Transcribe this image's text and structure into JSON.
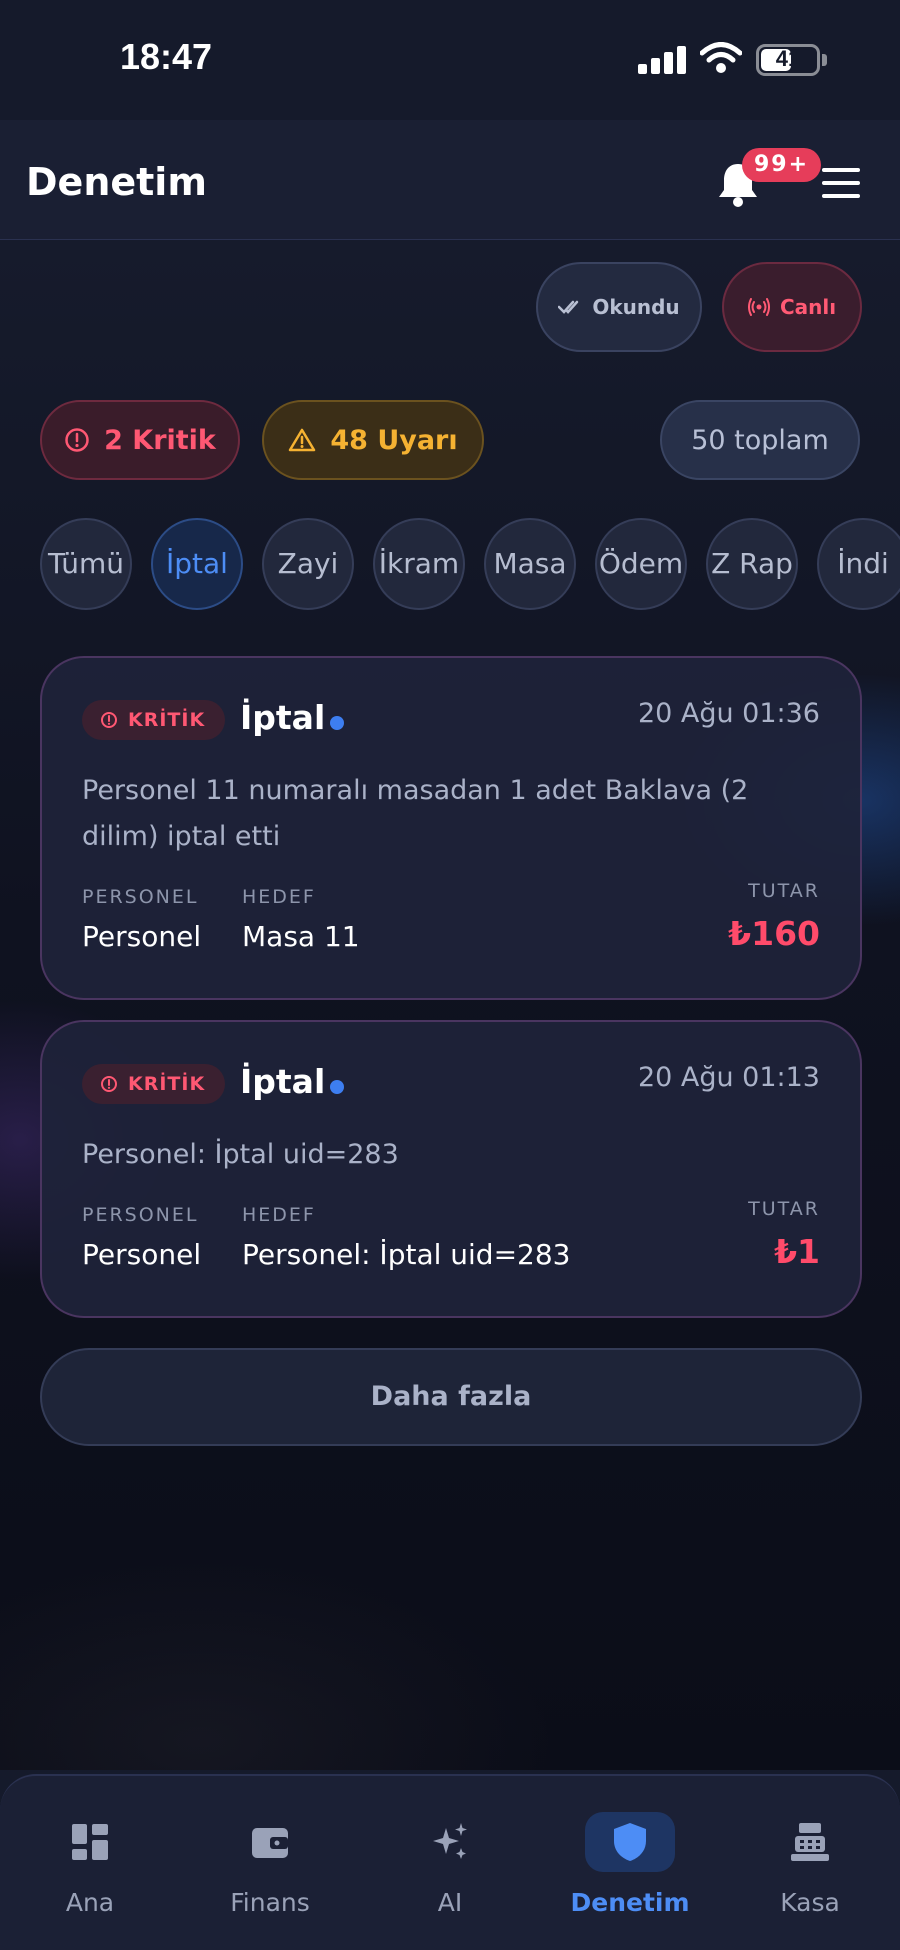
{
  "status_bar": {
    "time": "18:47",
    "battery": "41"
  },
  "header": {
    "title": "Denetim",
    "notification_count": "99+"
  },
  "actions": {
    "read_label": "Okundu",
    "live_label": "Canlı"
  },
  "summary": {
    "critical": "2 Kritik",
    "warnings": "48 Uyarı",
    "total": "50 toplam"
  },
  "filters": [
    "Tümü",
    "İptal",
    "Zayi",
    "İkram",
    "Masa",
    "Ödem",
    "Z Rap",
    "İndi"
  ],
  "active_filter": "İptal",
  "cards": [
    {
      "severity": "KRİTİK",
      "title": "İptal",
      "date": "20 Ağu 01:36",
      "description": "Personel 11 numaralı masadan 1 adet Baklava (2 dilim) iptal etti",
      "staff_label": "PERSONEL",
      "staff": "Personel",
      "target_label": "HEDEF",
      "target": "Masa 11",
      "amount_label": "TUTAR",
      "amount": "₺160"
    },
    {
      "severity": "KRİTİK",
      "title": "İptal",
      "date": "20 Ağu 01:13",
      "description": "Personel: İptal uid=283",
      "staff_label": "PERSONEL",
      "staff": "Personel",
      "target_label": "HEDEF",
      "target": "Personel: İptal uid=283",
      "amount_label": "TUTAR",
      "amount": "₺1"
    }
  ],
  "more_label": "Daha fazla",
  "nav": [
    {
      "label": "Ana",
      "icon": "dashboard-icon"
    },
    {
      "label": "Finans",
      "icon": "wallet-icon"
    },
    {
      "label": "AI",
      "icon": "sparkles-icon"
    },
    {
      "label": "Denetim",
      "icon": "shield-icon"
    },
    {
      "label": "Kasa",
      "icon": "cash-register-icon"
    }
  ],
  "active_nav": "Denetim",
  "colors": {
    "accent": "#4d8df5",
    "critical": "#ff5873",
    "warning": "#f5b232",
    "background": "#151a2b"
  }
}
